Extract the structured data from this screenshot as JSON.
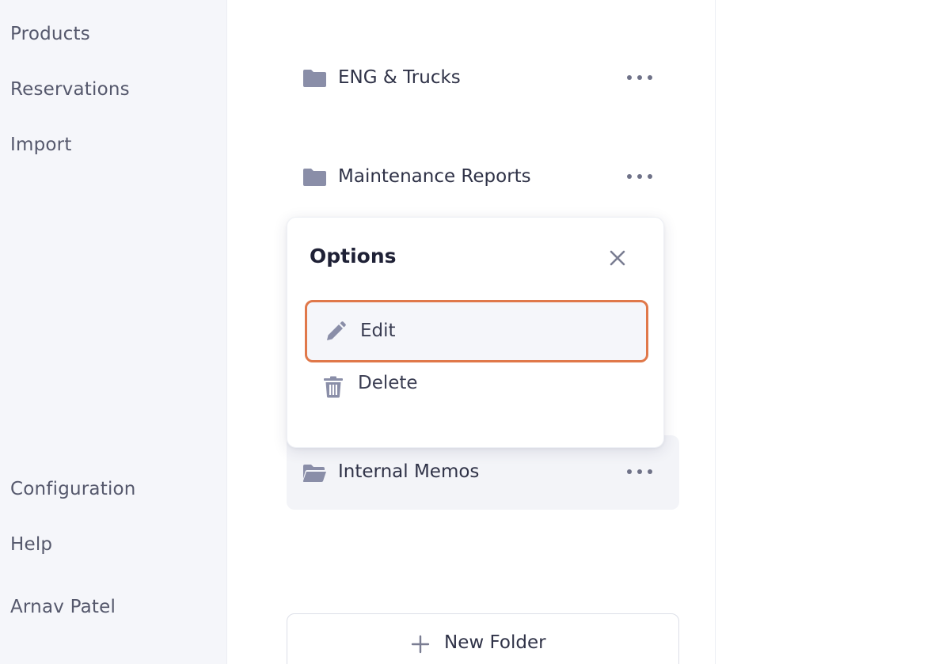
{
  "sidebar": {
    "items": [
      {
        "label": "Products"
      },
      {
        "label": "Reservations"
      },
      {
        "label": "Import"
      },
      {
        "label": "Configuration"
      },
      {
        "label": "Help"
      },
      {
        "label": "Arnav Patel"
      }
    ]
  },
  "folders": [
    {
      "name": "ENG & Trucks",
      "icon": "folder-icon"
    },
    {
      "name": "Maintenance Reports",
      "icon": "folder-icon"
    },
    {
      "name": "Internal Memos",
      "icon": "folder-open-icon"
    }
  ],
  "options_popover": {
    "title": "Options",
    "items": [
      {
        "label": "Edit",
        "icon": "pencil-icon"
      },
      {
        "label": "Delete",
        "icon": "trash-icon"
      }
    ]
  },
  "new_folder": {
    "label": "New Folder",
    "icon": "plus-icon"
  },
  "colors": {
    "sidebar_bg": "#f5f6fa",
    "highlight_border": "#e0784a",
    "icon": "#8a8ea8",
    "text": "#2f3247"
  }
}
